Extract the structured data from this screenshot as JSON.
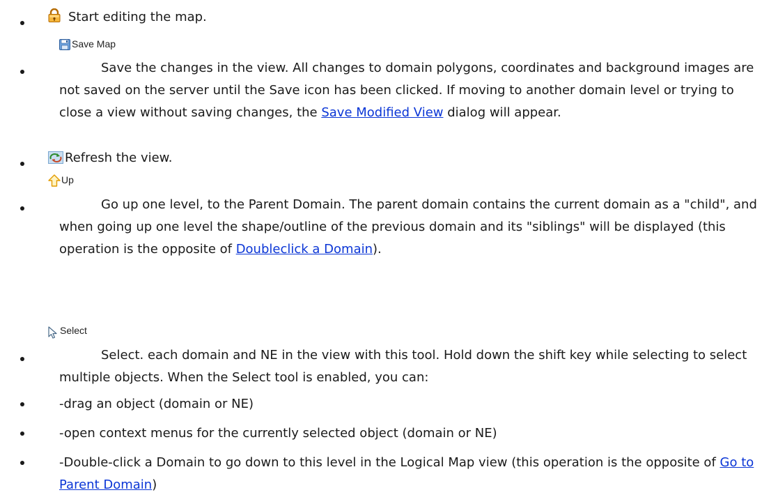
{
  "items": [
    {
      "icon": "lock-icon",
      "text": "Start editing the map."
    },
    {
      "icon": "save-icon",
      "label": "Save Map",
      "pre": "Save the changes in the view. All changes to domain polygons, coordinates and background images are not saved on the server until the Save icon has been clicked. If moving to another domain level or trying to close a view without saving changes, the ",
      "link": "Save Modified View",
      "post": " dialog will appear."
    },
    {
      "icon": "refresh-icon",
      "text": "Refresh the view."
    },
    {
      "icon": "up-arrow-icon",
      "label": "Up",
      "pre": "Go up one level, to the Parent Domain. The parent domain contains the current domain as a \"child\", and when going up one level the shape/outline of the previous domain and its \"siblings\" will be displayed (this operation is the opposite of ",
      "link": "Doubleclick a Domain",
      "post": ")."
    },
    {
      "icon": "select-cursor-icon",
      "label": "Select",
      "text": "Select. each domain and NE in the view with this tool. Hold down the shift key while selecting to select multiple objects. When the Select tool is enabled, you can:"
    },
    {
      "text": "-drag an object (domain or NE)"
    },
    {
      "text": "-open context menus for the currently selected object (domain or NE)"
    },
    {
      "pre": "-Double-click a Domain to go down to this level in the Logical Map view (this operation is the opposite of ",
      "link": "Go to Parent Domain",
      "post": ")"
    }
  ]
}
